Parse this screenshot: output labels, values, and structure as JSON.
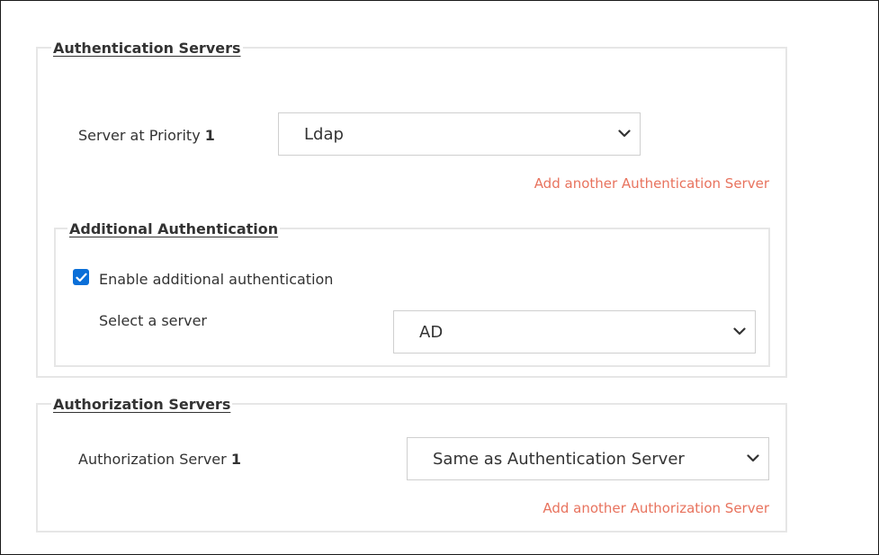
{
  "authentication": {
    "legend": "Authentication Servers",
    "priority_label": "Server at Priority",
    "priority_number": "1",
    "server_value": "Ldap",
    "add_link": "Add another Authentication Server"
  },
  "additional": {
    "legend": "Additional Authentication",
    "enable_label": "Enable additional authentication",
    "enable_checked": true,
    "select_label": "Select a server",
    "server_value": "AD"
  },
  "authorization": {
    "legend": "Authorization Servers",
    "server_label": "Authorization Server",
    "server_number": "1",
    "server_value": "Same as Authentication Server",
    "add_link": "Add another Authorization Server"
  },
  "colors": {
    "link": "#e8735e",
    "checkbox": "#0b6fd8",
    "border": "#e6e6e6"
  }
}
